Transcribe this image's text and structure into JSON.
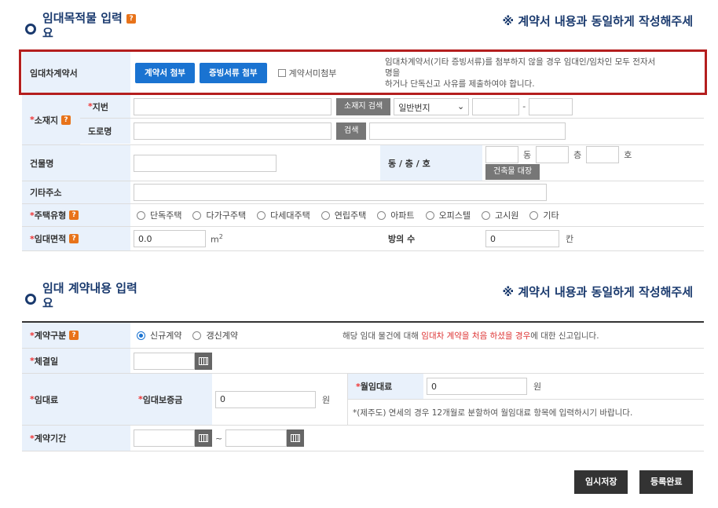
{
  "section1": {
    "title": "임대목적물 입력",
    "title_tail": "요",
    "note": "※ 계약서 내용과 동일하게 작성해주세",
    "contract_row": {
      "label": "임대차계약서",
      "btn_attach_contract": "계약서 첨부",
      "btn_attach_evidence": "증빙서류 첨부",
      "checkbox_label": "계약서미첨부",
      "notice_line1": "임대차계약서(기타 증빙서류)를 첨부하지 않을 경우 임대인/임차인 모두 전자서",
      "notice_line2": "명을",
      "notice_line3": "하거나 단독신고 사유를 제출하여야 합니다."
    },
    "location": {
      "label": "소재지",
      "lot_label": "지번",
      "road_label": "도로명",
      "btn_search_location": "소재지 검색",
      "lot_type_selected": "일반번지",
      "dash": "-",
      "btn_search": "검색"
    },
    "building": {
      "label": "건물명",
      "dong_label": "동 / 층 / 호",
      "dong": "동",
      "floor": "층",
      "ho": "호",
      "btn_ledger": "건축물 대장"
    },
    "extra_address": {
      "label": "기타주소"
    },
    "housing_type": {
      "label": "주택유형",
      "options": [
        "단독주택",
        "다가구주택",
        "다세대주택",
        "연립주택",
        "아파트",
        "오피스텔",
        "고시원",
        "기타"
      ]
    },
    "area": {
      "label": "임대면적",
      "value": "0.0",
      "unit": "m",
      "unit_sup": "2",
      "rooms_label": "방의 수",
      "rooms_value": "0",
      "rooms_unit": "칸"
    }
  },
  "section2": {
    "title": "임대 계약내용 입력",
    "title_tail": "요",
    "note": "※ 계약서 내용과 동일하게 작성해주세",
    "contract_type": {
      "label": "계약구분",
      "options": [
        "신규계약",
        "갱신계약"
      ],
      "selected": "신규계약",
      "desc_pre": "해당 임대 물건에 대해 ",
      "desc_highlight": "임대차 계약을 처음 하셨을 경우",
      "desc_post": "에 대한 신고입니다."
    },
    "sign_date": {
      "label": "체결일"
    },
    "rent": {
      "label": "임대료",
      "deposit_label": "임대보증금",
      "deposit_value": "0",
      "unit": "원",
      "monthly_label": "월임대료",
      "monthly_value": "0",
      "monthly_unit": "원",
      "monthly_note": "*(제주도) 연세의 경우 12개월로 분할하여 월임대료 항목에 입력하시기 바랍니다."
    },
    "period": {
      "label": "계약기간",
      "tilde": "~"
    }
  },
  "footer": {
    "temp_save": "임시저장",
    "complete": "등록완료"
  },
  "colors": {
    "accent": "#1a73d1",
    "title": "#1a3a6e",
    "highlight_box": "#b41e1e",
    "badge": "#e8731a"
  }
}
